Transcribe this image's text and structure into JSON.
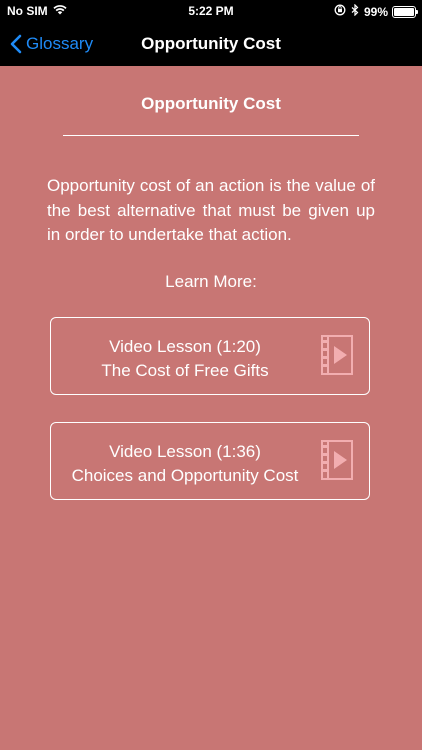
{
  "status_bar": {
    "carrier": "No SIM",
    "time": "5:22 PM",
    "battery_percent": "99%",
    "battery_level": 0.99
  },
  "nav": {
    "back_label": "Glossary",
    "title": "Opportunity Cost"
  },
  "main": {
    "title": "Opportunity Cost",
    "definition": "Opportunity cost of an action is the value of the best alternative that must be given up in order to undertake that action.",
    "learn_more_label": "Learn More:",
    "lessons": [
      {
        "duration_line": "Video Lesson (1:20)",
        "title": "The Cost of Free Gifts",
        "icon": "video-play-icon"
      },
      {
        "duration_line": "Video Lesson (1:36)",
        "title": "Choices and Opportunity Cost",
        "icon": "video-play-icon"
      }
    ]
  },
  "colors": {
    "background": "#c87674",
    "bar": "#000000",
    "accent": "#1f8bf7",
    "icon": "#f2aeb0"
  }
}
